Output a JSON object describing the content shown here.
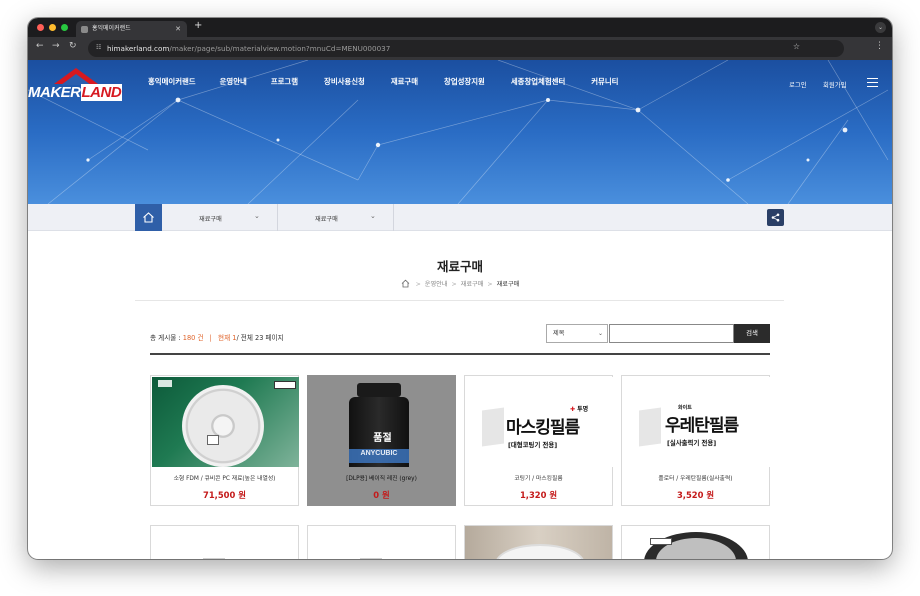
{
  "browser": {
    "tab_title": "홍익메이커랜드",
    "url_host": "himakerland.com",
    "url_path": "/maker/page/sub/materialview.motion?mnuCd=MENU000037"
  },
  "site": {
    "logo_word1": "MAKER",
    "logo_word2": "LAND",
    "nav": [
      "홍익메이커랜드",
      "운영안내",
      "프로그램",
      "장비사용신청",
      "재료구매",
      "창업성장지원",
      "세종창업체험센터",
      "커뮤니티"
    ],
    "login": "로그인",
    "join": "회원가입"
  },
  "subnav": {
    "select1": "재료구매",
    "select2": "재료구매"
  },
  "page": {
    "title": "재료구매",
    "breadcrumb": [
      "운영안내",
      "재료구매",
      "재료구매"
    ]
  },
  "board": {
    "total_label": "총 게시물 :",
    "total_value": "180 건",
    "current_label": "현재",
    "current_value": "1",
    "pages_text": "/ 전체 23 페이지",
    "search_option": "제목",
    "search_placeholder": "",
    "search_button": "검색"
  },
  "products": [
    {
      "name": "소형 FDM / 큐비콘 PC 재료(높은 내열성)",
      "price": "71,500 원",
      "thumb": "filament-spool-photo"
    },
    {
      "name": "[DLP용] 베이직 레진 (grey)",
      "price": "0 원",
      "thumb": "resin-bottle-photo",
      "overlay": "품절",
      "brand": "ANYCUBIC"
    },
    {
      "name": "코팅기 / 마스킹필름",
      "price": "1,320 원",
      "thumb": "masking-film-graphic",
      "badge": "투명",
      "big": "마스킹필름",
      "sub": "[대형코팅기 전용]"
    },
    {
      "name": "플로터 / 우레탄필름(실사출력)",
      "price": "3,520 원",
      "thumb": "urethane-film-graphic",
      "badge": "화이트",
      "big": "우레탄필름",
      "sub": "[실사출력기 전용]"
    }
  ],
  "colors": {
    "accent": "#2f5fa8",
    "price": "#c41a1a",
    "highlight": "#e0632a"
  }
}
